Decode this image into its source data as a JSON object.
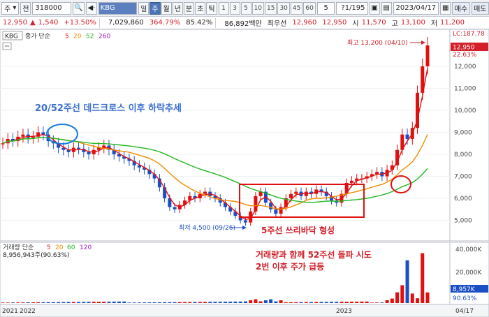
{
  "toolbar": {
    "market": "주",
    "code_prefix": "전",
    "code": "318000",
    "stock_name": "KBG",
    "periods": [
      "일",
      "주",
      "월",
      "년",
      "분",
      "초",
      "틱"
    ],
    "active_period": "주",
    "numbers": [
      "1",
      "3",
      "5",
      "10",
      "15",
      "30",
      "45",
      "60"
    ],
    "count": "5",
    "page_info": "?1/195",
    "date": "2023/04/17",
    "buy": "매수",
    "sell": "매도"
  },
  "quote": {
    "price": "12,950",
    "change": "1,540",
    "change_pct": "+13.50%",
    "volume": "7,029,860",
    "volume_ratio": "364.79%",
    "strength": "85.42%",
    "amount": "86,892백만",
    "prev_label": "최우선",
    "ask": "12,960",
    "bid": "12,950",
    "open_label": "시",
    "open": "11,570",
    "high_label": "고",
    "high": "13,100",
    "low_label": "저",
    "low": "11,200"
  },
  "price_panel": {
    "name_tag": "KBG",
    "ma_label": "종가 단순",
    "ma_periods": [
      "5",
      "20",
      "52",
      "260"
    ],
    "ma_colors": [
      "#e01010",
      "#f08c00",
      "#1fb81f",
      "#a020c0"
    ],
    "lc_label": "LC:187.78",
    "current_tag": "12,950",
    "pct_tag": "22.63%",
    "y_ticks": [
      "12,000",
      "11,000",
      "10,000",
      "9,000",
      "8,000",
      "7,000",
      "6,000",
      "5,000"
    ],
    "max_label": "최고 13,200 (04/10)",
    "min_label": "최저 4,500 (09/26)",
    "annotation_dead_cross": "20/52주선 데드크로스 이후 하락추세",
    "annotation_floor": "5주선 쓰리바닥 형성",
    "annotation_break_1": "거래량과 함께 52주선 돌파 시도",
    "annotation_break_2": "2번 이후 주가 급등"
  },
  "volume_panel": {
    "label": "거래량 단순",
    "ma_periods": [
      "5",
      "20",
      "60",
      "120"
    ],
    "value": "8,956,943주(90.63%)",
    "y_ticks": [
      "40,000K",
      "20,000K",
      "0K"
    ],
    "current_tag": "8,957K",
    "pct_tag": "90.63%"
  },
  "x_axis": {
    "labels": [
      "2021",
      "2022",
      "2023"
    ],
    "date_tag": "04/17"
  }
}
